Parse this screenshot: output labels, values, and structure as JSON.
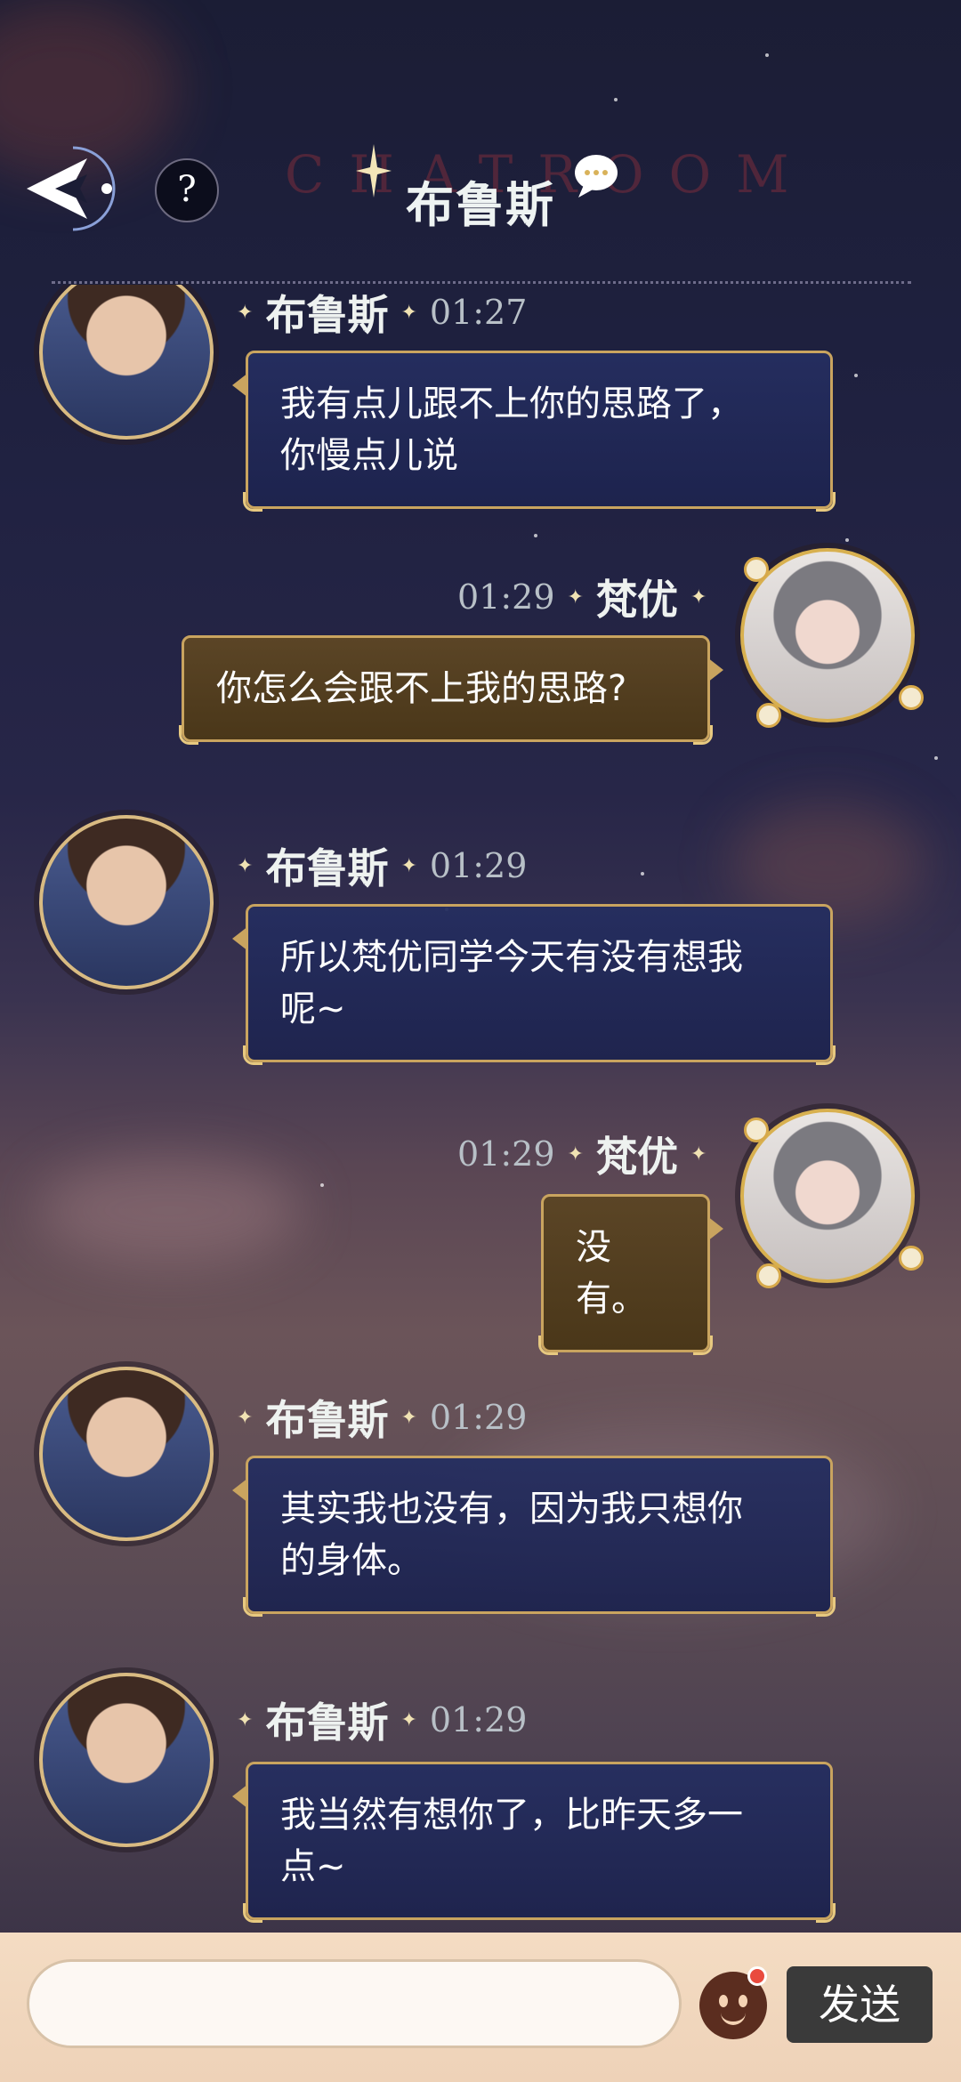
{
  "header": {
    "title": "布鲁斯",
    "watermark": "CHATROOM",
    "help_label": "?"
  },
  "messages": [
    {
      "sender": "布鲁斯",
      "time": "01:27",
      "side": "left",
      "text_lines": [
        "我有点儿跟不上你的思路了，",
        "你慢点儿说"
      ]
    },
    {
      "sender": "梵优",
      "time": "01:29",
      "side": "right",
      "text_lines": [
        "你怎么会跟不上我的思路?"
      ]
    },
    {
      "sender": "布鲁斯",
      "time": "01:29",
      "side": "left",
      "text_lines": [
        "所以梵优同学今天有没有想我",
        "呢~"
      ]
    },
    {
      "sender": "梵优",
      "time": "01:29",
      "side": "right",
      "text_lines": [
        "没有。"
      ]
    },
    {
      "sender": "布鲁斯",
      "time": "01:29",
      "side": "left",
      "text_lines": [
        "其实我也没有，因为我只想你",
        "的身体。"
      ]
    },
    {
      "sender": "布鲁斯",
      "time": "01:29",
      "side": "left",
      "text_lines": [
        "我当然有想你了，比昨天多一",
        "点~"
      ]
    }
  ],
  "composer": {
    "input_value": "",
    "send_label": "发送"
  },
  "colors": {
    "bubble_left": "#252e60",
    "bubble_right": "#5b4526",
    "gold_border": "#c9a45f",
    "send_button": "#3a3a3a"
  },
  "icons": {
    "back": "back-arrow-icon",
    "help": "question-icon",
    "title_bubble": "chat-bubble-icon",
    "emoji": "emoji-face-icon"
  }
}
